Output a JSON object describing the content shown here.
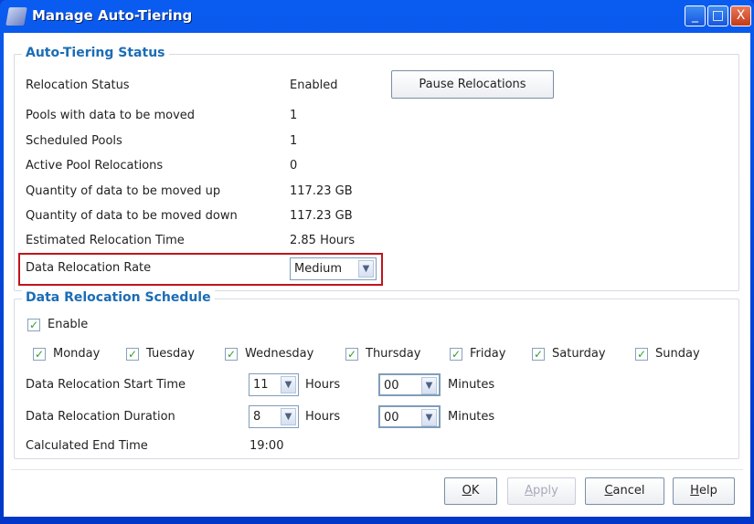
{
  "window": {
    "title": "Manage Auto-Tiering",
    "minimize": "_",
    "maximize": "□",
    "close": "X"
  },
  "status": {
    "legend": "Auto-Tiering Status",
    "rows": [
      {
        "label": "Relocation Status",
        "value": "Enabled"
      },
      {
        "label": "Pools with data to be moved",
        "value": "1"
      },
      {
        "label": "Scheduled Pools",
        "value": "1"
      },
      {
        "label": "Active Pool Relocations",
        "value": "0"
      },
      {
        "label": "Quantity of data to be moved up",
        "value": "117.23 GB"
      },
      {
        "label": "Quantity of data to be moved down",
        "value": "117.23 GB"
      },
      {
        "label": "Estimated Relocation Time",
        "value": "2.85 Hours"
      }
    ],
    "pause_button": "Pause Relocations",
    "rate_label": "Data Relocation Rate",
    "rate_value": "Medium",
    "highlight_color": "#c0151b"
  },
  "schedule": {
    "legend": "Data Relocation Schedule",
    "enable_label": "Enable",
    "enable_checked": true,
    "days": [
      {
        "label": "Monday",
        "checked": true
      },
      {
        "label": "Tuesday",
        "checked": true
      },
      {
        "label": "Wednesday",
        "checked": true
      },
      {
        "label": "Thursday",
        "checked": true
      },
      {
        "label": "Friday",
        "checked": true
      },
      {
        "label": "Saturday",
        "checked": true
      },
      {
        "label": "Sunday",
        "checked": true
      }
    ],
    "start_label": "Data Relocation Start Time",
    "start_hours": "11",
    "start_minutes": "00",
    "duration_label": "Data Relocation Duration",
    "duration_hours": "8",
    "duration_minutes": "00",
    "hours_label": "Hours",
    "minutes_label": "Minutes",
    "end_label": "Calculated End Time",
    "end_value": "19:00"
  },
  "buttons": {
    "ok_key": "O",
    "ok_rest": "K",
    "apply_key": "A",
    "apply_rest": "pply",
    "cancel_key": "C",
    "cancel_rest": "ancel",
    "help_key": "H",
    "help_rest": "elp"
  }
}
